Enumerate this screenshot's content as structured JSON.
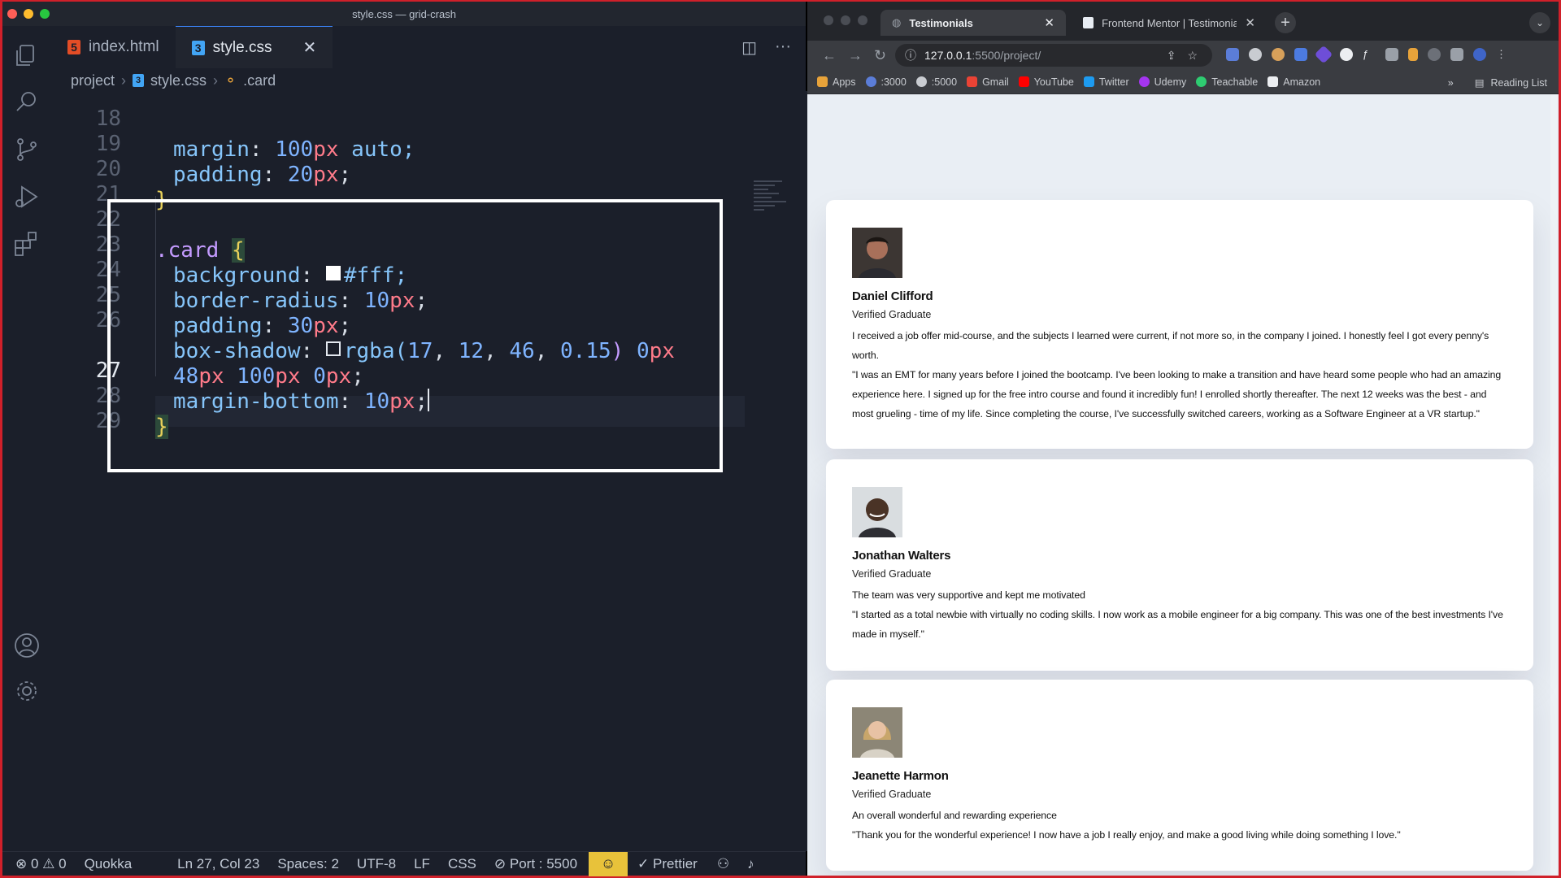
{
  "vscode": {
    "window_title": "style.css — grid-crash",
    "tabs": [
      {
        "icon": "5",
        "label": "index.html"
      },
      {
        "icon": "3",
        "label": "style.css",
        "close": "✕"
      }
    ],
    "breadcrumb": {
      "root": "project",
      "file": "style.css",
      "symbol": ".card"
    },
    "line_numbers": [
      "18",
      "19",
      "20",
      "21",
      "22",
      "23",
      "24",
      "25",
      "26",
      "",
      "27",
      "28",
      "29"
    ],
    "code": {
      "l18_prop": "margin",
      "l18_num": "100",
      "l18_unit": "px",
      "l18_rest": " auto;",
      "l19_prop": "padding",
      "l19_num": "20",
      "l19_unit": "px",
      "l20": "}",
      "l22_sel": ".card",
      "l22_brace": "{",
      "l23_prop": "background",
      "l23_val": "#fff;",
      "l24_prop": "border-radius",
      "l24_num": "10",
      "l24_unit": "px",
      "l25_prop": "padding",
      "l25_num": "30",
      "l25_unit": "px",
      "l26_prop": "box-shadow",
      "l26_fn": "rgba(",
      "l26_a": "17",
      "l26_b": "12",
      "l26_c": "46",
      "l26_d": "0.15",
      "l26_close": ")",
      "l26_e": "0",
      "l26_eu": "px",
      "l26b_a": "48",
      "l26b_au": "px",
      "l26b_b": "100",
      "l26b_bu": "px",
      "l26b_c": "0",
      "l26b_cu": "px",
      "l27_prop": "margin-bottom",
      "l27_num": "10",
      "l27_unit": "px",
      "l28": "}"
    },
    "status": {
      "errors": "⊗ 0 ⚠ 0",
      "quokka": "Quokka",
      "position": "Ln 27, Col 23",
      "spaces": "Spaces: 2",
      "encoding": "UTF-8",
      "eol": "LF",
      "language": "CSS",
      "port": "⊘ Port : 5500",
      "prettier": "✓ Prettier"
    }
  },
  "browser": {
    "tabs": [
      {
        "label": "Testimonials",
        "close": "✕"
      },
      {
        "label": "Frontend Mentor | Testimonials",
        "close": "✕"
      }
    ],
    "url_host": "127.0.0.1",
    "url_path": ":5500/project/",
    "bookmarks": [
      "Apps",
      ":3000",
      ":5000",
      "Gmail",
      "YouTube",
      "Twitter",
      "Udemy",
      "Teachable",
      "Amazon"
    ],
    "bookmarks_more": "»",
    "reading_list": "Reading List"
  },
  "testimonials": [
    {
      "name": "Daniel Clifford",
      "role": "Verified Graduate",
      "summary": "I received a job offer mid-course, and the subjects I learned were current, if not more so, in the company I joined. I honestly feel I got every penny's worth.",
      "quote": "\"I was an EMT for many years before I joined the bootcamp. I've been looking to make a transition and have heard some people who had an amazing experience here. I signed up for the free intro course and found it incredibly fun! I enrolled shortly thereafter. The next 12 weeks was the best - and most grueling - time of my life. Since completing the course, I've successfully switched careers, working as a Software Engineer at a VR startup.\""
    },
    {
      "name": "Jonathan Walters",
      "role": "Verified Graduate",
      "summary": "The team was very supportive and kept me motivated",
      "quote": "\"I started as a total newbie with virtually no coding skills. I now work as a mobile engineer for a big company. This was one of the best investments I've made in myself.\""
    },
    {
      "name": "Jeanette Harmon",
      "role": "Verified Graduate",
      "summary": "An overall wonderful and rewarding experience",
      "quote": "\"Thank you for the wonderful experience! I now have a job I really enjoy, and make a good living while doing something I love.\""
    }
  ]
}
